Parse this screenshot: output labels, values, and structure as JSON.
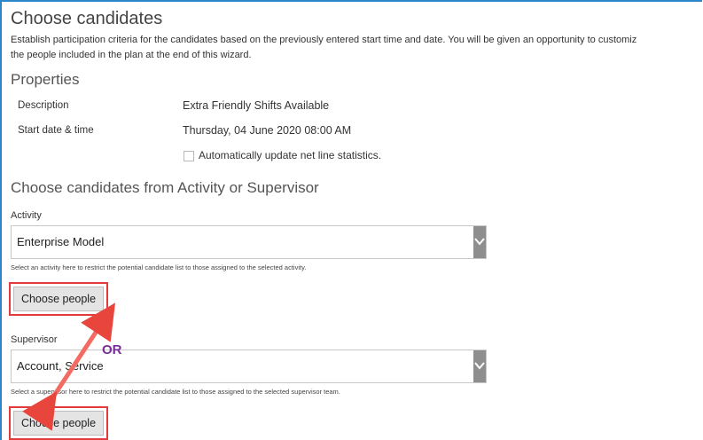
{
  "header": {
    "title": "Choose candidates",
    "description_line1": "Establish participation criteria for the candidates based on the previously entered start time and date. You will be given an opportunity to customiz",
    "description_line2": "the people included in the plan at the end of this wizard."
  },
  "properties": {
    "heading": "Properties",
    "description_label": "Description",
    "description_value": "Extra Friendly Shifts Available",
    "start_label": "Start date & time",
    "start_value": "Thursday, 04 June 2020 08:00 AM",
    "auto_update_label": "Automatically update net line statistics.",
    "auto_update_checked": false
  },
  "choose_section": {
    "heading": "Choose candidates from Activity or Supervisor",
    "activity": {
      "label": "Activity",
      "value": "Enterprise Model",
      "hint": "Select an activity here to restrict the potential candidate list to those assigned to the selected activity.",
      "button": "Choose people"
    },
    "supervisor": {
      "label": "Supervisor",
      "value": "Account, Service",
      "hint": "Select a supervisor here to restrict the potential candidate list to those assigned to the selected supervisor team.",
      "button": "Choose people"
    },
    "or_label": "OR"
  },
  "colors": {
    "highlight_red": "#e23b3b",
    "or_purple": "#7b2a9b",
    "frame_blue": "#2b87c9"
  }
}
